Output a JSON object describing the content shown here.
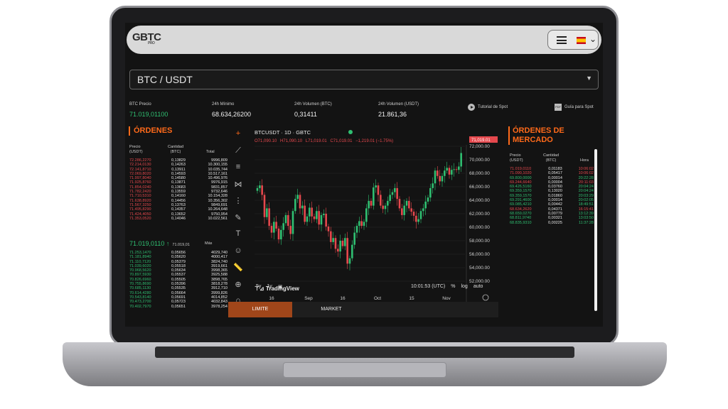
{
  "app": {
    "logo_text": "GBTC",
    "logo_sub": "PRO",
    "flag": "spain-flag-icon"
  },
  "pair": {
    "label": "BTC / USDT"
  },
  "stats": [
    {
      "label": "BTC Precio",
      "value": "71.019,01100"
    },
    {
      "label": "24h Mínimo",
      "value": "68.634,26200"
    },
    {
      "label": "24h Volumen (BTC)",
      "value": "0,31411"
    },
    {
      "label": "24h Volumen (USDT)",
      "value": "21.861,36"
    }
  ],
  "links": {
    "tutorial": "Tutorial de Spot",
    "guide": "Guía para Spot"
  },
  "orders": {
    "title": "ÓRDENES",
    "col_price": "Precio\n(USDT)",
    "col_amount": "Cantidad\n(BTC)",
    "col_total": "Total",
    "asks": [
      [
        "72.286,2270",
        "0,13829",
        "9996,809"
      ],
      [
        "72.214,0130",
        "0,14263",
        "10.300,155"
      ],
      [
        "72.141,8710",
        "0,13911",
        "10.035,744"
      ],
      [
        "72.069,8020",
        "0,14593",
        "10.517,161"
      ],
      [
        "71.997,8040",
        "0,14580",
        "10.496,976"
      ],
      [
        "71.925,8760",
        "0,13871",
        "9976,915"
      ],
      [
        "71.854,0240",
        "0,13683",
        "9831,857"
      ],
      [
        "71.782,2420",
        "0,13559",
        "9732,646"
      ],
      [
        "71.710,5310",
        "0,14160",
        "10.154,328"
      ],
      [
        "71.638,8920",
        "0,14456",
        "10.356,302"
      ],
      [
        "71.567,3250",
        "0,13763",
        "9849,691"
      ],
      [
        "71.495,8290",
        "0,14357",
        "10.264,648"
      ],
      [
        "71.424,4050",
        "0,13652",
        "9750,954"
      ],
      [
        "71.353,0520",
        "0,14046",
        "10.022,561"
      ]
    ],
    "mid_price": "71.019,0110",
    "mid_ref": "71.019,01",
    "more": "Más",
    "bids": [
      [
        "71.253,1470",
        "0,05656",
        "4029,740"
      ],
      [
        "71.181,8940",
        "0,05620",
        "4000,417"
      ],
      [
        "71.110,7120",
        "0,05379",
        "3824,740"
      ],
      [
        "71.039,6020",
        "0,05518",
        "3919,661"
      ],
      [
        "70.968,5620",
        "0,05634",
        "3998,365"
      ],
      [
        "70.897,5930",
        "0,05537",
        "3925,588"
      ],
      [
        "70.826,6960",
        "0,05505",
        "3898,765"
      ],
      [
        "70.755,8690",
        "0,05396",
        "3818,278"
      ],
      [
        "70.685,1130",
        "0,05535",
        "3912,710"
      ],
      [
        "70.614,4280",
        "0,05664",
        "3999,826"
      ],
      [
        "70.543,8140",
        "0,05691",
        "4014,852"
      ],
      [
        "70.473,2700",
        "0,05723",
        "4032,843"
      ],
      [
        "70.402,7970",
        "0,05651",
        "3978,254"
      ]
    ]
  },
  "market_orders": {
    "title": "ÓRDENES DE MERCADO",
    "col_price": "Precio\n(USDT)",
    "col_amount": "Cantidad\n(BTC)",
    "col_time": "Hora",
    "rows": [
      [
        "71.019,0110",
        "0,01183",
        "10:06:02",
        "red"
      ],
      [
        "71.090,1020",
        "0,05417",
        "10:06:02",
        "red"
      ],
      [
        "69.800,0000",
        "0,00014",
        "20:22:28",
        "green"
      ],
      [
        "69.244,6640",
        "0,00004",
        "20:11:03",
        "red"
      ],
      [
        "69.426,5160",
        "0,03760",
        "20:04:24",
        "green"
      ],
      [
        "69.359,1570",
        "0,13020",
        "20:04:24",
        "green"
      ],
      [
        "69.359,1570",
        "0,01860",
        "20:03:29",
        "green"
      ],
      [
        "69.291,4600",
        "0,00014",
        "20:02:05",
        "green"
      ],
      [
        "69.085,4210",
        "0,00442",
        "18:49:51",
        "green"
      ],
      [
        "68.634,2620",
        "0,04371",
        "16:15:41",
        "red"
      ],
      [
        "68.659,0270",
        "0,00779",
        "13:12:39",
        "green"
      ],
      [
        "68.811,9740",
        "0,00321",
        "13:03:50",
        "green"
      ],
      [
        "68.835,9310",
        "0,00225",
        "11:37:28",
        "green"
      ]
    ]
  },
  "chart": {
    "symbol": "BTCUSDT · 1D · GBTC",
    "ohlc": {
      "o": "O71,090.10",
      "h": "H71,090.10",
      "l": "L71,019.01",
      "c": "C71,019.01",
      "chg": "−1,219.01 (−1.75%)"
    },
    "last_price_tag": "71,019.01",
    "brand": "TradingView",
    "range_buttons": [
      "5y",
      "1y"
    ],
    "clock": "10:01:53 (UTC)",
    "opts": [
      "%",
      "log",
      "auto"
    ]
  },
  "chart_data": {
    "type": "candlestick",
    "ylim": [
      52000,
      72000
    ],
    "y_ticks": [
      72000,
      70000,
      68000,
      66000,
      64000,
      62000,
      60000,
      58000,
      56000,
      54000,
      52000
    ],
    "y_tick_labels": [
      "72,000.00",
      "70,000.00",
      "68,000.00",
      "66,000.00",
      "64,000.00",
      "62,000.00",
      "60,000.00",
      "58,000.00",
      "56,000.00",
      "54,000.00",
      "52,000.00"
    ],
    "x_tick_labels": [
      "16",
      "Sep",
      "16",
      "Oct",
      "15",
      "Nov"
    ],
    "closes": [
      65800,
      66200,
      64800,
      61500,
      62800,
      60200,
      59200,
      60800,
      59800,
      58200,
      59600,
      60600,
      61800,
      60200,
      59000,
      62400,
      64200,
      64800,
      62800,
      63200,
      60800,
      61600,
      62900,
      61600,
      61200,
      62400,
      60400,
      61800,
      62000,
      60100,
      59400,
      57800,
      58400,
      56800,
      56400,
      58000,
      57200,
      58400,
      54600,
      55400,
      57400,
      59200,
      60200,
      60900,
      60200,
      60800,
      62800,
      63900,
      63200,
      65900,
      66200,
      64800,
      63200,
      62700,
      63200,
      63900,
      64800,
      65200,
      65800,
      64200,
      62800,
      61800,
      63200,
      63900,
      62800,
      62300,
      61700,
      60800,
      61200,
      62400,
      62800,
      63800,
      64400,
      65800,
      66500,
      68400,
      67600,
      66800,
      67600,
      68400,
      68800,
      67800,
      68500,
      68600,
      68500,
      69000,
      71000
    ]
  },
  "form": {
    "tab_limit": "LIMITE",
    "tab_market": "MARKET"
  }
}
